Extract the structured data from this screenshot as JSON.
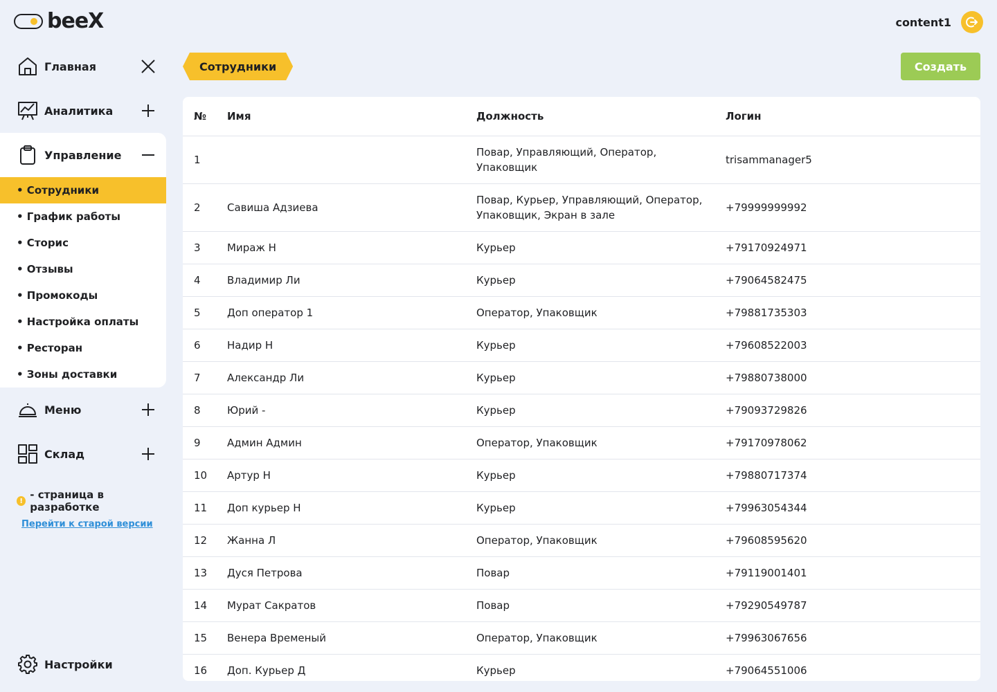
{
  "header": {
    "logo_text": "beeX",
    "user_name": "content1"
  },
  "sidebar": {
    "items": [
      {
        "label": "Главная",
        "icon": "home-icon",
        "action": "close"
      },
      {
        "label": "Аналитика",
        "icon": "analytics-board-icon",
        "action": "plus"
      },
      {
        "label": "Управление",
        "icon": "clipboard-icon",
        "action": "minus"
      }
    ],
    "sub_items": [
      "• Сотрудники",
      "• График работы",
      "• Сторис",
      "• Отзывы",
      "• Промокоды",
      "• Настройка оплаты",
      "• Ресторан",
      "• Зоны доставки"
    ],
    "items_after": [
      {
        "label": "Меню",
        "icon": "cloche-icon",
        "action": "plus"
      },
      {
        "label": "Склад",
        "icon": "warehouse-grid-icon",
        "action": "plus"
      }
    ],
    "dev_note": "- страница в разработке",
    "old_version_link": "Перейти к старой версии",
    "settings_label": "Настройки"
  },
  "main": {
    "breadcrumb": "Сотрудники",
    "create_label": "Создать",
    "columns": [
      "№",
      "Имя",
      "Должность",
      "Логин"
    ],
    "rows": [
      {
        "num": "1",
        "name": "",
        "role": "Повар, Управляющий, Оператор, Упаковщик",
        "login": "trisammanager5"
      },
      {
        "num": "2",
        "name": "Савиша Адзиева",
        "role": "Повар, Курьер, Управляющий, Оператор, Упаковщик, Экран в зале",
        "login": "+79999999992"
      },
      {
        "num": "3",
        "name": "Мираж Н",
        "role": "Курьер",
        "login": "+79170924971"
      },
      {
        "num": "4",
        "name": "Владимир Ли",
        "role": "Курьер",
        "login": "+79064582475"
      },
      {
        "num": "5",
        "name": "Доп оператор 1",
        "role": "Оператор, Упаковщик",
        "login": "+79881735303"
      },
      {
        "num": "6",
        "name": "Надир Н",
        "role": "Курьер",
        "login": "+79608522003"
      },
      {
        "num": "7",
        "name": "Александр Ли",
        "role": "Курьер",
        "login": "+79880738000"
      },
      {
        "num": "8",
        "name": "Юрий -",
        "role": "Курьер",
        "login": "+79093729826"
      },
      {
        "num": "9",
        "name": "Админ Админ",
        "role": "Оператор, Упаковщик",
        "login": "+79170978062"
      },
      {
        "num": "10",
        "name": "Артур Н",
        "role": "Курьер",
        "login": "+79880717374"
      },
      {
        "num": "11",
        "name": "Доп курьер Н",
        "role": "Курьер",
        "login": "+79963054344"
      },
      {
        "num": "12",
        "name": "Жанна Л",
        "role": "Оператор, Упаковщик",
        "login": "+79608595620"
      },
      {
        "num": "13",
        "name": "Дуся Петрова",
        "role": "Повар",
        "login": "+79119001401"
      },
      {
        "num": "14",
        "name": "Мурат Сакратов",
        "role": "Повар",
        "login": "+79290549787"
      },
      {
        "num": "15",
        "name": "Венера Временый",
        "role": "Оператор, Упаковщик",
        "login": "+79963067656"
      },
      {
        "num": "16",
        "name": "Доп. Курьер Д",
        "role": "Курьер",
        "login": "+79064551006"
      }
    ]
  },
  "colors": {
    "accent": "#f7c02b",
    "create_button": "#9ccb55",
    "background": "#edf1f9",
    "link": "#2f8fd8"
  }
}
